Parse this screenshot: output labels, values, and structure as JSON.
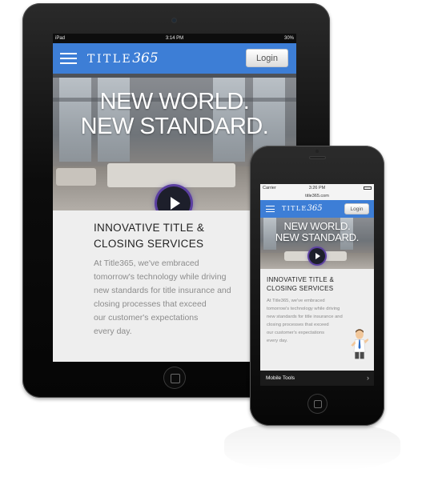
{
  "ipad": {
    "status": {
      "carrier": "iPad",
      "time": "3:14 PM",
      "battery": "30%"
    },
    "nav": {
      "brand": "TITLE",
      "brand_num": "365",
      "login": "Login"
    },
    "hero": {
      "line1": "NEW WORLD.",
      "line2": "NEW STANDARD."
    },
    "section": {
      "title_line1": "INNOVATIVE TITLE &",
      "title_line2": "CLOSING SERVICES",
      "body_lines": [
        "At Title365, we've embraced",
        "tomorrow's technology while driving",
        "new standards for title insurance and",
        "closing processes that exceed",
        "our customer's expectations",
        "every day."
      ]
    }
  },
  "iphone": {
    "status": {
      "carrier": "Carrier",
      "time": "3:26 PM"
    },
    "url": "title365.com",
    "nav": {
      "brand": "TITLE",
      "brand_num": "365",
      "login": "Login"
    },
    "hero": {
      "line1": "NEW WORLD.",
      "line2": "NEW STANDARD."
    },
    "section": {
      "title_line1": "INNOVATIVE TITLE &",
      "title_line2": "CLOSING SERVICES",
      "body_lines": [
        "At Title365, we've embraced",
        "tomorrow's technology while driving",
        "new standards for title insurance and",
        "closing processes that exceed",
        "our customer's expectations",
        "every day."
      ]
    },
    "footer": {
      "label": "Mobile Tools"
    }
  },
  "colors": {
    "nav_blue": "#3d7ed6",
    "play_ring": "#5b3fa0",
    "body_gray": "#8c8c8c"
  }
}
